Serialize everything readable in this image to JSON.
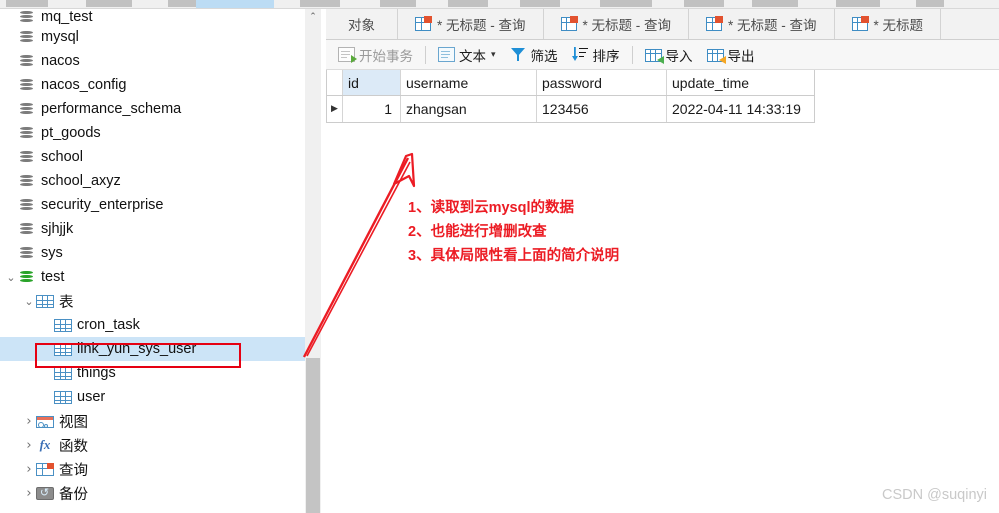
{
  "window": {
    "watermark": "CSDN @suqinyi"
  },
  "tree": {
    "items": [
      {
        "label": "mq_test",
        "icon": "database-icon",
        "indent": 0,
        "chevron": "",
        "selected": false,
        "clipped": true
      },
      {
        "label": "mysql",
        "icon": "database-icon",
        "indent": 0,
        "chevron": "",
        "selected": false
      },
      {
        "label": "nacos",
        "icon": "database-icon",
        "indent": 0,
        "chevron": "",
        "selected": false
      },
      {
        "label": "nacos_config",
        "icon": "database-icon",
        "indent": 0,
        "chevron": "",
        "selected": false
      },
      {
        "label": "performance_schema",
        "icon": "database-icon",
        "indent": 0,
        "chevron": "",
        "selected": false
      },
      {
        "label": "pt_goods",
        "icon": "database-icon",
        "indent": 0,
        "chevron": "",
        "selected": false
      },
      {
        "label": "school",
        "icon": "database-icon",
        "indent": 0,
        "chevron": "",
        "selected": false
      },
      {
        "label": "school_axyz",
        "icon": "database-icon",
        "indent": 0,
        "chevron": "",
        "selected": false
      },
      {
        "label": "security_enterprise",
        "icon": "database-icon",
        "indent": 0,
        "chevron": "",
        "selected": false
      },
      {
        "label": "sjhjjk",
        "icon": "database-icon",
        "indent": 0,
        "chevron": "",
        "selected": false
      },
      {
        "label": "sys",
        "icon": "database-icon",
        "indent": 0,
        "chevron": "",
        "selected": false
      },
      {
        "label": "test",
        "icon": "database-open-icon",
        "indent": 0,
        "chevron": "v",
        "selected": false
      },
      {
        "label": "表",
        "icon": "table-folder-icon",
        "indent": 1,
        "chevron": "v",
        "selected": false
      },
      {
        "label": "cron_task",
        "icon": "table-icon",
        "indent": 2,
        "chevron": "",
        "selected": false
      },
      {
        "label": "link_yun_sys_user",
        "icon": "table-icon",
        "indent": 2,
        "chevron": "",
        "selected": true
      },
      {
        "label": "things",
        "icon": "table-icon",
        "indent": 2,
        "chevron": "",
        "selected": false
      },
      {
        "label": "user",
        "icon": "table-icon",
        "indent": 2,
        "chevron": "",
        "selected": false
      },
      {
        "label": "视图",
        "icon": "view-icon",
        "indent": 1,
        "chevron": ">",
        "selected": false
      },
      {
        "label": "函数",
        "icon": "function-icon",
        "indent": 1,
        "chevron": ">",
        "selected": false
      },
      {
        "label": "查询",
        "icon": "query-icon",
        "indent": 1,
        "chevron": ">",
        "selected": false
      },
      {
        "label": "备份",
        "icon": "backup-icon",
        "indent": 1,
        "chevron": ">",
        "selected": false
      }
    ],
    "scrollbar": {
      "up_arrow": "⌃"
    }
  },
  "tabs": [
    {
      "label": "对象",
      "icon": "",
      "active": false
    },
    {
      "label": "* 无标题 - 查询",
      "icon": "query-tab-icon",
      "active": false
    },
    {
      "label": "* 无标题 - 查询",
      "icon": "query-tab-icon",
      "active": false
    },
    {
      "label": "* 无标题 - 查询",
      "icon": "query-tab-icon",
      "active": false
    },
    {
      "label": "* 无标题",
      "icon": "query-tab-icon",
      "active": false
    }
  ],
  "toolbar": {
    "begin_transaction": "开始事务",
    "text": "文本",
    "text_caret": "▾",
    "filter": "筛选",
    "sort": "排序",
    "import": "导入",
    "export": "导出"
  },
  "grid": {
    "columns": [
      "id",
      "username",
      "password",
      "update_time"
    ],
    "rows": [
      {
        "indicator": "▶",
        "id": "1",
        "username": "zhangsan",
        "password": "123456",
        "update_time": "2022-04-11 14:33:19"
      }
    ]
  },
  "annotation": {
    "color": "#ec1c24",
    "lines": [
      "1、读取到云mysql的数据",
      "2、也能进行增删改查",
      "3、具体局限性看上面的简介说明"
    ]
  },
  "colors": {
    "selection_blue": "#cce4f7",
    "red_accent": "#e60012",
    "toolbar_bg": "#f7f7f7"
  }
}
